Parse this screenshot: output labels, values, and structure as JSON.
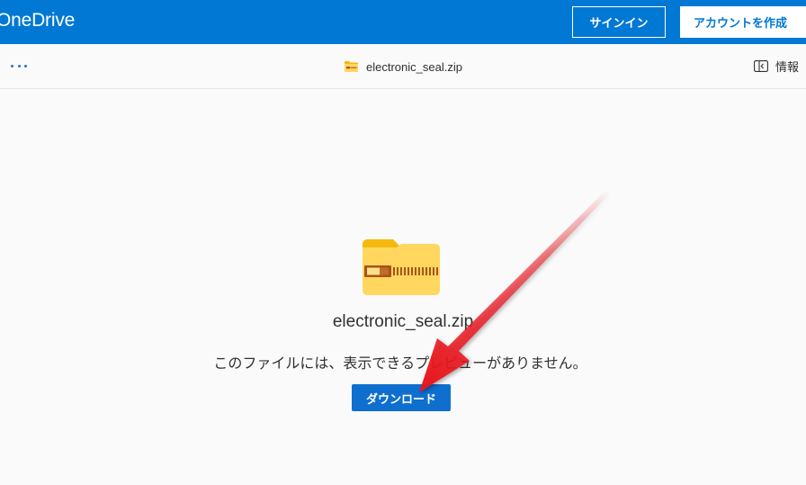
{
  "app": {
    "brand": "OneDrive"
  },
  "header": {
    "signin_label": "サインイン",
    "create_account_label": "アカウントを作成"
  },
  "commandbar": {
    "more_icon": "more-horizontal-icon",
    "file_name": "electronic_seal.zip",
    "info_label": "情報",
    "info_icon": "info-pane-icon"
  },
  "preview": {
    "file_icon": "zip-folder-icon",
    "file_name": "electronic_seal.zip",
    "message": "このファイルには、表示できるプレビューがありません。",
    "download_label": "ダウンロード"
  },
  "annotation": {
    "arrow_color": "#e8141c"
  },
  "colors": {
    "accent": "#0078d4",
    "button": "#0f6fcf"
  }
}
